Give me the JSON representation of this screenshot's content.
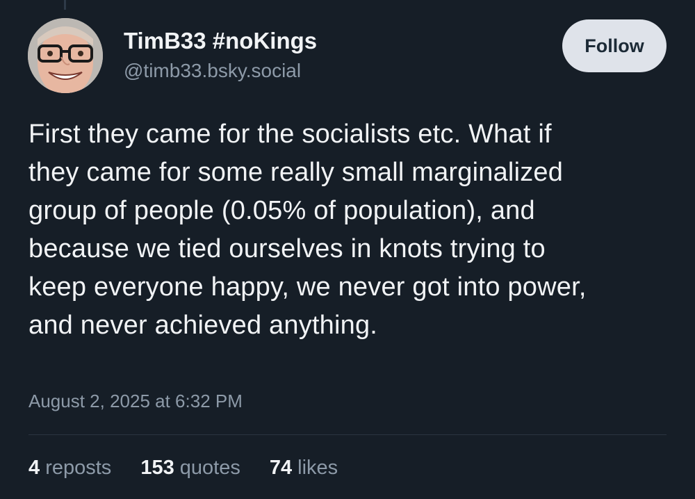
{
  "author": {
    "display_name": "TimB33 #noKings",
    "handle": "@timb33.bsky.social",
    "avatar": "avatar-photo"
  },
  "follow_button": {
    "label": "Follow"
  },
  "post": {
    "lines": [
      "First they came for the socialists etc. What if",
      "they came for some really small marginalized",
      "group of people (0.05% of population), and",
      "because we tied ourselves in knots trying to",
      "keep everyone happy, we never got into power,",
      "and never achieved anything."
    ],
    "timestamp": "August 2, 2025 at 6:32 PM"
  },
  "stats": {
    "reposts": {
      "count": "4",
      "label": "reposts"
    },
    "quotes": {
      "count": "153",
      "label": "quotes"
    },
    "likes": {
      "count": "74",
      "label": "likes"
    }
  },
  "colors": {
    "background": "#161e27",
    "text": "#f1f3f5",
    "muted": "#8d9aa8",
    "button_bg": "#dfe3ea"
  }
}
